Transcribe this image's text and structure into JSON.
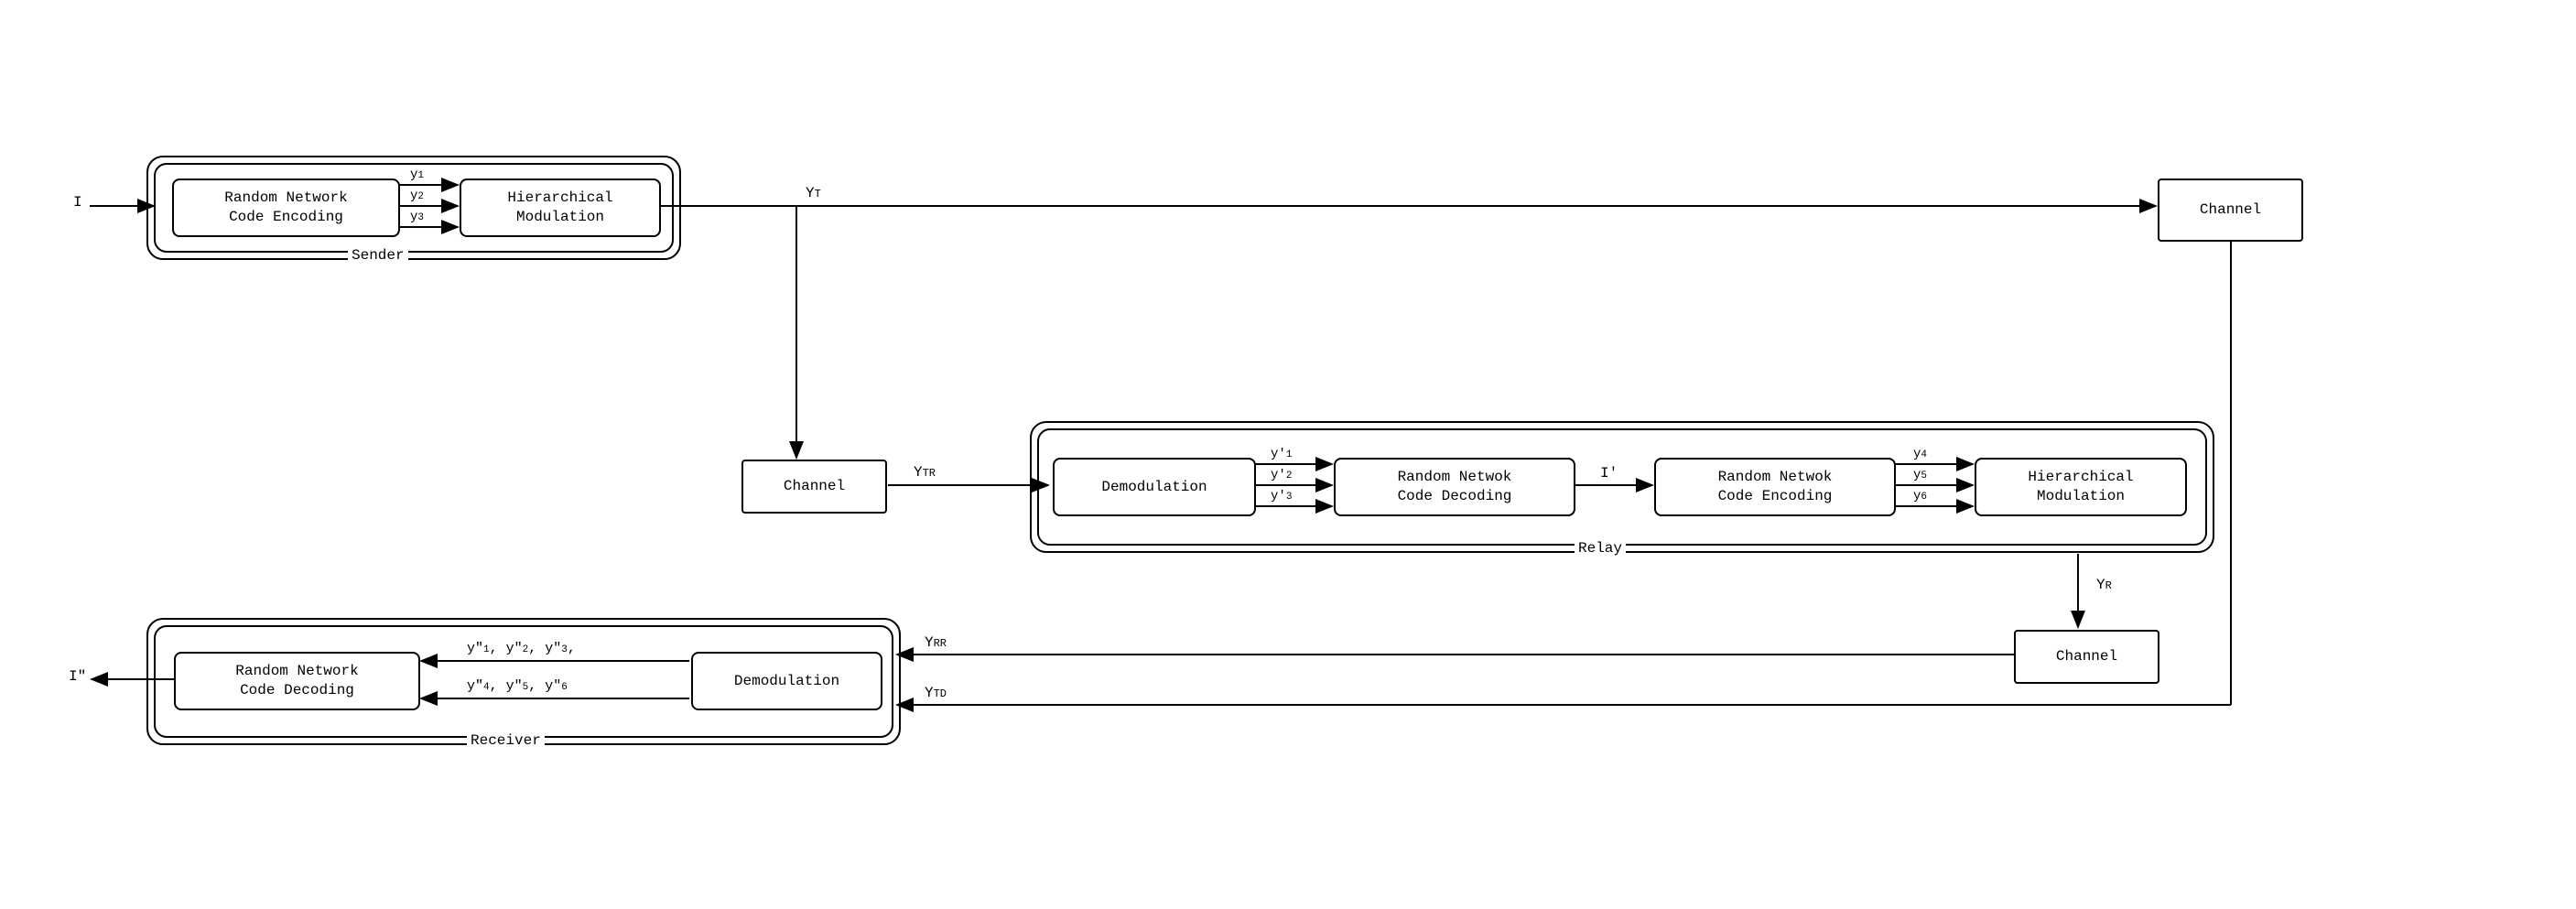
{
  "input": "I",
  "sender": {
    "label": "Sender",
    "block1": "Random Network\nCode Encoding",
    "block2": "Hierarchical\nModulation",
    "y1": "y₅1",
    "y2": "y₅2",
    "y3": "y₅3"
  },
  "relay": {
    "label": "Relay",
    "block1": "Demodulation",
    "block2": "Random Netwok\nCode Decoding",
    "block3": "Random Netwok\nCode Encoding",
    "block4": "Hierarchical\nModulation",
    "y1p": "y₅'1",
    "y2p": "y₅'2",
    "y3p": "y₅'3",
    "iprime": "I'",
    "y4": "y₅4",
    "y5": "y₅5",
    "y6": "y₅6"
  },
  "receiver": {
    "label": "Receiver",
    "block1": "Random Network\nCode Decoding",
    "block2": "Demodulation",
    "out": "I\"",
    "line1": "y₅\"1, y₅\"2, y₅\"3,",
    "line2": "y₅\"4, y₅\"5, y₅\"6"
  },
  "channels": {
    "c1": "Channel",
    "c2": "Channel",
    "c3": "Channel"
  },
  "signals": {
    "yt": "YₜT",
    "ytr": "YₜTR",
    "yr": "YₜR",
    "yrr": "YₜRR",
    "ytd": "YₜTD"
  }
}
